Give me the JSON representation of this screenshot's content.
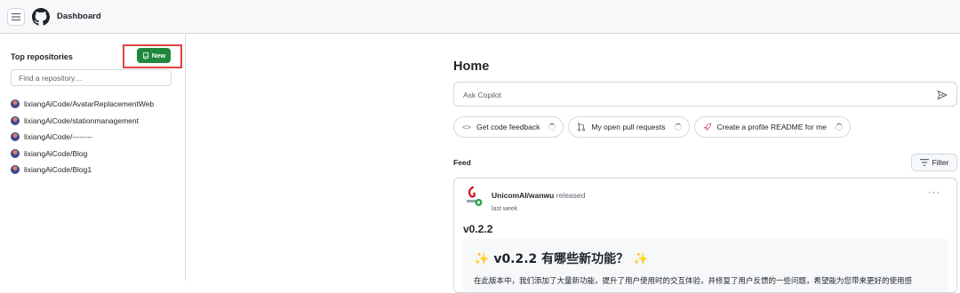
{
  "header": {
    "title": "Dashboard",
    "menu_icon": "hamburger-menu-icon",
    "logo_icon": "github-logo-icon"
  },
  "sidebar": {
    "heading": "Top repositories",
    "new_button": "New",
    "find_placeholder": "Find a repository…",
    "repositories": [
      "lixiangAiCode/AvatarReplacementWeb",
      "lixiangAiCode/stationmanagement",
      "lixiangAiCode/--------",
      "lixiangAiCode/Blog",
      "lixiangAiCode/Blog1"
    ]
  },
  "main": {
    "title": "Home",
    "copilot_placeholder": "Ask Copilot",
    "chips": [
      {
        "icon": "code-icon",
        "label": "Get code feedback"
      },
      {
        "icon": "pull-request-icon",
        "label": "My open pull requests"
      },
      {
        "icon": "rocket-icon",
        "label": "Create a profile README for me"
      }
    ],
    "feed_label": "Feed",
    "filter_button": "Filter"
  },
  "feed_card": {
    "repo": "UnicomAI/wanwu",
    "verb": "released",
    "time": "last week",
    "version": "v0.2.2",
    "release_heading": "v0.2.2 有哪些新功能？",
    "release_text": "在此版本中，我们添加了大量新功能，提升了用户使用时的交互体验，并修复了用户反馈的一些问题，希望能为您带来更好的使用感"
  },
  "colors": {
    "accent_green": "#1f883d",
    "highlight_red": "#e0443e",
    "border": "#d1d9e0"
  }
}
